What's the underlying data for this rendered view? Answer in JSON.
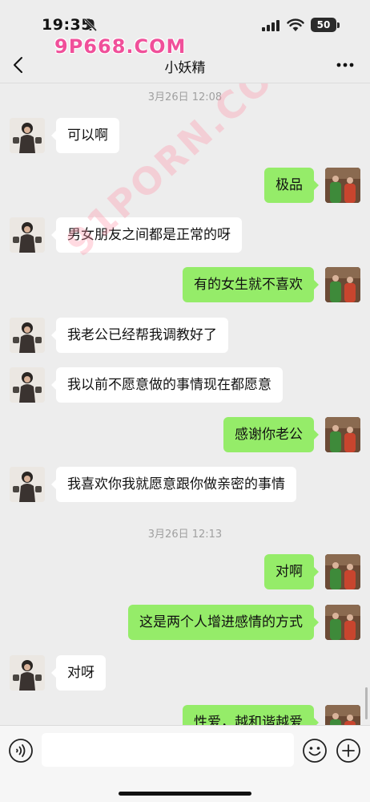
{
  "status_bar": {
    "time": "19:35",
    "battery": "50"
  },
  "watermark_top": "9P668.COM",
  "watermark_diag": "91PORN.COM",
  "nav": {
    "title": "小妖精"
  },
  "timestamps": [
    "3月26日 12:08",
    "3月26日 12:13"
  ],
  "messages": [
    {
      "side": "left",
      "text": "可以啊"
    },
    {
      "side": "right",
      "text": "极品"
    },
    {
      "side": "left",
      "text": "男女朋友之间都是正常的呀"
    },
    {
      "side": "right",
      "text": "有的女生就不喜欢"
    },
    {
      "side": "left",
      "text": "我老公已经帮我调教好了"
    },
    {
      "side": "left",
      "text": "我以前不愿意做的事情现在都愿意"
    },
    {
      "side": "right",
      "text": "感谢你老公"
    },
    {
      "side": "left",
      "text": "我喜欢你我就愿意跟你做亲密的事情"
    },
    {
      "side": "right",
      "text": "对啊"
    },
    {
      "side": "right",
      "text": "这是两个人增进感情的方式"
    },
    {
      "side": "left",
      "text": "对呀"
    },
    {
      "side": "right",
      "text": "性爱，越和谐越爱"
    }
  ],
  "input": {
    "value": "",
    "placeholder": ""
  },
  "colors": {
    "self_bubble": "#95ec69",
    "other_bubble": "#ffffff",
    "background": "#ededed"
  },
  "icons": [
    "back-icon",
    "more-icon",
    "voice-icon",
    "emoji-icon",
    "plus-icon"
  ]
}
